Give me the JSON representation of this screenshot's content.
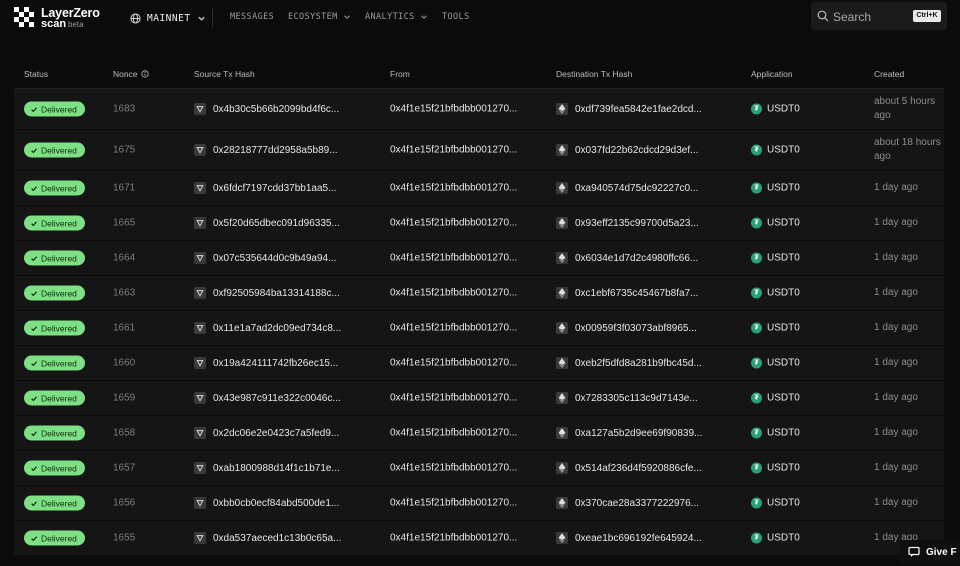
{
  "brand": {
    "name_line1": "LayerZero",
    "name_line2": "scan",
    "tag": "beta"
  },
  "network": {
    "label": "MAINNET"
  },
  "nav": [
    "MESSAGES",
    "ECOSYSTEM",
    "ANALYTICS",
    "TOOLS"
  ],
  "search": {
    "placeholder": "Search",
    "shortcut": "Ctrl+K"
  },
  "table": {
    "headers": [
      "Status",
      "Nonce",
      "Source Tx Hash",
      "From",
      "Destination Tx Hash",
      "Application",
      "Created"
    ],
    "rows": [
      {
        "status": "Delivered",
        "nonce": "1683",
        "src": "0x4b30c5b66b2099bd4f6c...",
        "from": "0x4f1e15f21bfbdbb001270...",
        "dst": "0xdf739fea5842e1fae2dcd...",
        "app": "USDT0",
        "created": "about 5 hours ago"
      },
      {
        "status": "Delivered",
        "nonce": "1675",
        "src": "0x28218777dd2958a5b89...",
        "from": "0x4f1e15f21bfbdbb001270...",
        "dst": "0x037fd22b62cdcd29d3ef...",
        "app": "USDT0",
        "created": "about 18 hours ago"
      },
      {
        "status": "Delivered",
        "nonce": "1671",
        "src": "0x6fdcf7197cdd37bb1aa5...",
        "from": "0x4f1e15f21bfbdbb001270...",
        "dst": "0xa940574d75dc92227c0...",
        "app": "USDT0",
        "created": "1 day ago"
      },
      {
        "status": "Delivered",
        "nonce": "1665",
        "src": "0x5f20d65dbec091d96335...",
        "from": "0x4f1e15f21bfbdbb001270...",
        "dst": "0x93eff2135c99700d5a23...",
        "app": "USDT0",
        "created": "1 day ago"
      },
      {
        "status": "Delivered",
        "nonce": "1664",
        "src": "0x07c535644d0c9b49a94...",
        "from": "0x4f1e15f21bfbdbb001270...",
        "dst": "0x6034e1d7d2c4980ffc66...",
        "app": "USDT0",
        "created": "1 day ago"
      },
      {
        "status": "Delivered",
        "nonce": "1663",
        "src": "0xf92505984ba13314188c...",
        "from": "0x4f1e15f21bfbdbb001270...",
        "dst": "0xc1ebf6735c45467b8fa7...",
        "app": "USDT0",
        "created": "1 day ago"
      },
      {
        "status": "Delivered",
        "nonce": "1661",
        "src": "0x11e1a7ad2dc09ed734c8...",
        "from": "0x4f1e15f21bfbdbb001270...",
        "dst": "0x00959f3f03073abf8965...",
        "app": "USDT0",
        "created": "1 day ago"
      },
      {
        "status": "Delivered",
        "nonce": "1660",
        "src": "0x19a424111742fb26ec15...",
        "from": "0x4f1e15f21bfbdbb001270...",
        "dst": "0xeb2f5dfd8a281b9fbc45d...",
        "app": "USDT0",
        "created": "1 day ago"
      },
      {
        "status": "Delivered",
        "nonce": "1659",
        "src": "0x43e987c911e322c0046c...",
        "from": "0x4f1e15f21bfbdbb001270...",
        "dst": "0x7283305c113c9d7143e...",
        "app": "USDT0",
        "created": "1 day ago"
      },
      {
        "status": "Delivered",
        "nonce": "1658",
        "src": "0x2dc06e2e0423c7a5fed9...",
        "from": "0x4f1e15f21bfbdbb001270...",
        "dst": "0xa127a5b2d9ee69f90839...",
        "app": "USDT0",
        "created": "1 day ago"
      },
      {
        "status": "Delivered",
        "nonce": "1657",
        "src": "0xab1800988d14f1c1b71e...",
        "from": "0x4f1e15f21bfbdbb001270...",
        "dst": "0x514af236d4f5920886cfe...",
        "app": "USDT0",
        "created": "1 day ago"
      },
      {
        "status": "Delivered",
        "nonce": "1656",
        "src": "0xbb0cb0ecf84abd500de1...",
        "from": "0x4f1e15f21bfbdbb001270...",
        "dst": "0x370cae28a3377222976...",
        "app": "USDT0",
        "created": "1 day ago"
      },
      {
        "status": "Delivered",
        "nonce": "1655",
        "src": "0xda537aeced1c13b0c65a...",
        "from": "0x4f1e15f21bfbdbb001270...",
        "dst": "0xeae1bc696192fe645924...",
        "app": "USDT0",
        "created": "1 day ago"
      }
    ]
  },
  "feedback": {
    "label": "Give F"
  },
  "colors": {
    "delivered": "#7ee084",
    "tether": "#26a17b",
    "background": "#0b0b0b",
    "row": "#151515"
  },
  "icons": {
    "network": "globe-icon",
    "search": "search-icon",
    "source_chain": "chain-icon",
    "destination_chain": "ethereum-icon",
    "application": "tether-icon"
  }
}
